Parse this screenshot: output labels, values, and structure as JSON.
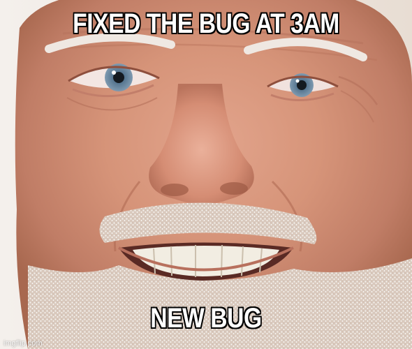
{
  "meme": {
    "top_text": "FIXED THE BUG AT 3AM",
    "bottom_text": "NEW BUG",
    "watermark": "imgflip.com",
    "image": "close-up photo of an older man with white stubble beard, forced pained smile showing teeth"
  },
  "colors": {
    "caption_fill": "#ffffff",
    "caption_outline": "#000000",
    "background": "#f1ece7"
  }
}
